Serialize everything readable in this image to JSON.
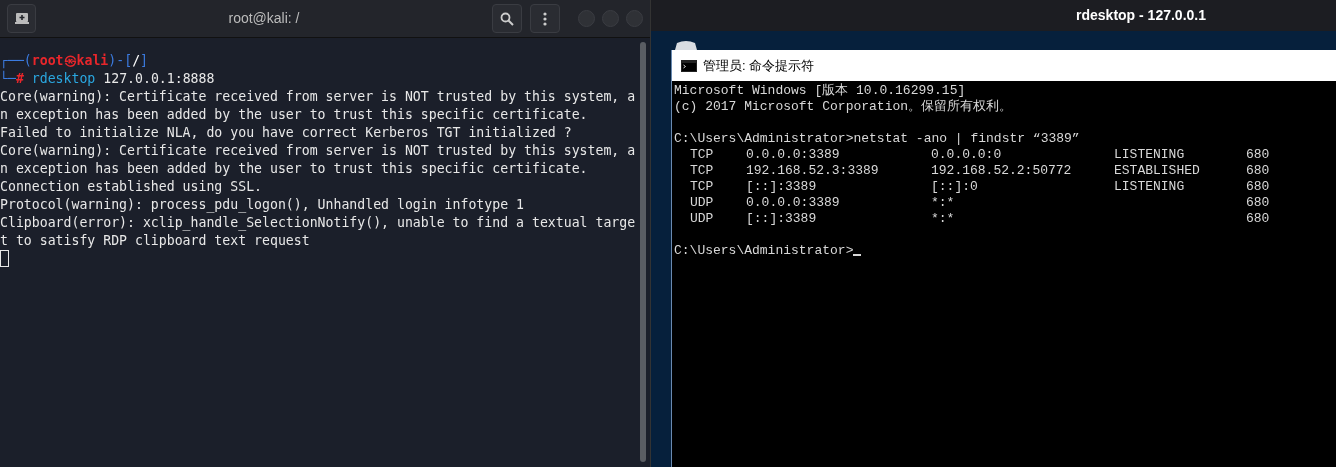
{
  "terminal": {
    "title": "root@kali: /",
    "prompt": {
      "open": "┌──(",
      "user": "root",
      "at": "㉿",
      "host": "kali",
      "mid": ")-[",
      "cwd": "/",
      "end": "]",
      "corner": "└─",
      "hash": "#",
      "command": "rdesktop",
      "args": "127.0.0.1:8888"
    },
    "output": [
      "Core(warning): Certificate received from server is NOT trusted by this system, a",
      "n exception has been added by the user to trust this specific certificate.",
      "Failed to initialize NLA, do you have correct Kerberos TGT initialized ?",
      "Core(warning): Certificate received from server is NOT trusted by this system, a",
      "n exception has been added by the user to trust this specific certificate.",
      "Connection established using SSL.",
      "Protocol(warning): process_pdu_logon(), Unhandled login infotype 1",
      "Clipboard(error): xclip_handle_SelectionNotify(), unable to find a textual targe",
      "t to satisfy RDP clipboard text request"
    ]
  },
  "rdesktop": {
    "title": "rdesktop - 127.0.0.1",
    "cmd": {
      "title": "管理员: 命令提示符",
      "header": [
        "Microsoft Windows [版本 10.0.16299.15]",
        "(c) 2017 Microsoft Corporation。保留所有权利。"
      ],
      "command": "C:\\Users\\Administrator>netstat -ano | findstr “3389”",
      "rows": [
        {
          "proto": "TCP",
          "local": "0.0.0.0:3389",
          "foreign": "0.0.0.0:0",
          "state": "LISTENING",
          "pid": "680"
        },
        {
          "proto": "TCP",
          "local": "192.168.52.3:3389",
          "foreign": "192.168.52.2:50772",
          "state": "ESTABLISHED",
          "pid": "680"
        },
        {
          "proto": "TCP",
          "local": "[::]:3389",
          "foreign": "[::]:0",
          "state": "LISTENING",
          "pid": "680"
        },
        {
          "proto": "UDP",
          "local": "0.0.0.0:3389",
          "foreign": "*:*",
          "pid": "680"
        },
        {
          "proto": "UDP",
          "local": "[::]:3389",
          "foreign": "*:*",
          "pid": "680"
        }
      ],
      "prompt": "C:\\Users\\Administrator>"
    }
  }
}
